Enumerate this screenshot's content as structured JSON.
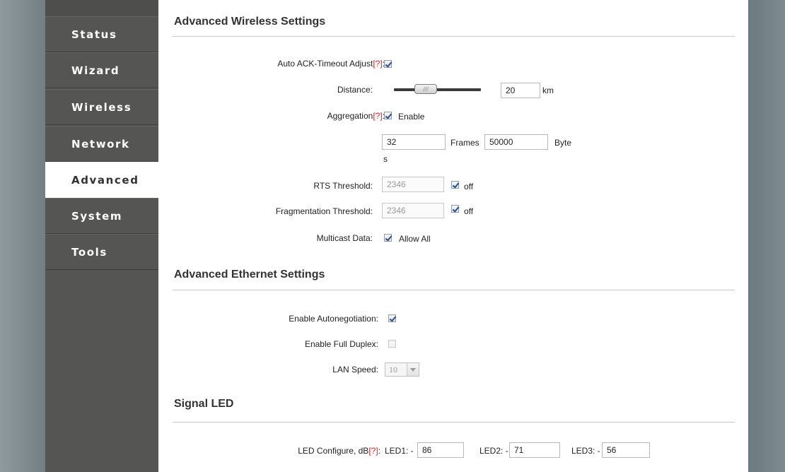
{
  "nav": {
    "items": [
      {
        "label": "Status"
      },
      {
        "label": "Wizard"
      },
      {
        "label": "Wireless"
      },
      {
        "label": "Network"
      },
      {
        "label": "Advanced"
      },
      {
        "label": "System"
      },
      {
        "label": "Tools"
      }
    ],
    "active": "Advanced"
  },
  "wireless": {
    "title": "Advanced Wireless Settings",
    "ack_label": "Auto ACK-Timeout Adjust",
    "help": "[?]",
    "colon": ":",
    "ack_checked": true,
    "distance_label": "Distance:",
    "distance_value": "20",
    "distance_unit": "km",
    "slider_grip": "///",
    "aggregation_label": "Aggregation",
    "aggregation_enable": "Enable",
    "aggregation_checked": true,
    "frames_value": "32",
    "frames_unit": "Frames",
    "bytes_value": "50000",
    "bytes_unit_a": "Byte",
    "bytes_unit_b": "s",
    "rts_label": "RTS Threshold:",
    "rts_value": "2346",
    "rts_off": "off",
    "rts_off_checked": true,
    "frag_label": "Fragmentation Threshold:",
    "frag_value": "2346",
    "frag_off": "off",
    "frag_off_checked": true,
    "multicast_label": "Multicast Data:",
    "multicast_allow": "Allow All",
    "multicast_checked": true
  },
  "ethernet": {
    "title": "Advanced Ethernet Settings",
    "autoneg_label": "Enable Autonegotiation:",
    "autoneg_checked": true,
    "duplex_label": "Enable Full Duplex:",
    "duplex_checked": false,
    "lan_speed_label": "LAN Speed:",
    "lan_speed_value": "10"
  },
  "signal_led": {
    "title": "Signal LED",
    "label": "LED Configure, dB",
    "help": "[?]",
    "colon": ":",
    "led1_label": "LED1: -",
    "led1_value": "86",
    "led2_label": "LED2: -",
    "led2_value": "71",
    "led3_label": "LED3: -",
    "led3_value": "56"
  }
}
